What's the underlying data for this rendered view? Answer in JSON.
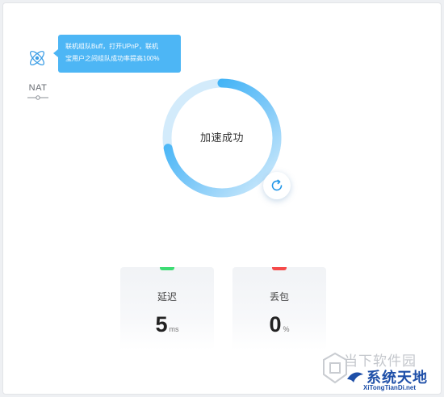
{
  "tooltip": {
    "line1": "联机组队Buff，打开UPnP，联机",
    "line2": "宝用户之间组队成功率提高100%"
  },
  "nat": {
    "label": "NAT"
  },
  "status": {
    "text": "加速成功",
    "progress": 0.72,
    "accent_color": "#1aa5f5",
    "light_color": "#d3ebfb"
  },
  "stats": {
    "latency": {
      "label": "延迟",
      "value": "5",
      "unit": "ms",
      "indicator_color": "#3ddc73"
    },
    "loss": {
      "label": "丢包",
      "value": "0",
      "unit": "%",
      "indicator_color": "#f54a4a"
    }
  },
  "icons": {
    "atom": "atom-icon",
    "refresh": "refresh-icon",
    "nat_switch": "switch-icon"
  },
  "watermark": {
    "top": "当下软件园",
    "main": "系统天地",
    "sub": "XiTongTianDi.net"
  }
}
